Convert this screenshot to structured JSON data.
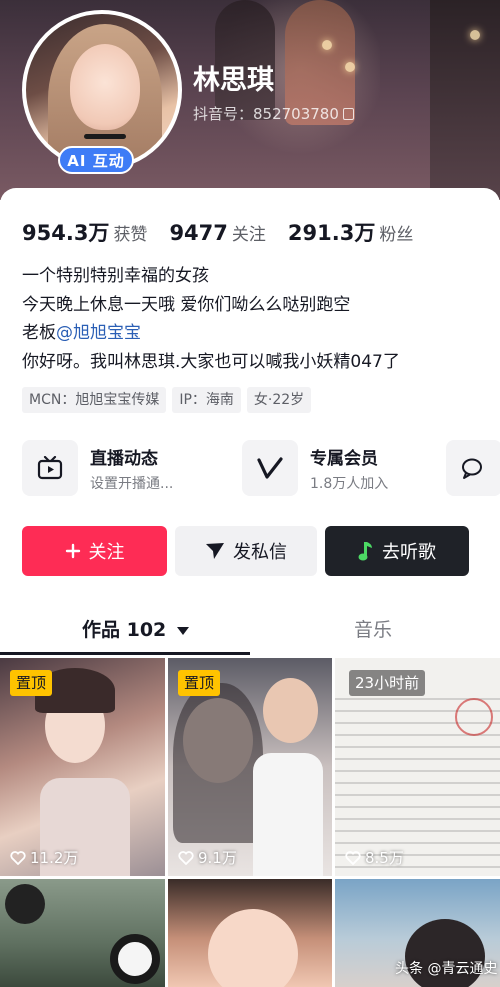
{
  "profile": {
    "nickname": "林思琪",
    "douyin_id": "抖音号：852703780",
    "ai_badge": "AI 互动"
  },
  "stats": [
    {
      "value": "954.3万",
      "label": "获赞"
    },
    {
      "value": "9477",
      "label": "关注"
    },
    {
      "value": "291.3万",
      "label": "粉丝"
    }
  ],
  "bio": {
    "line1": "一个特别特别幸福的女孩",
    "line2": "今天晚上休息一天哦 爱你们呦么么哒别跑空",
    "line3_prefix": "老板",
    "line3_mention": "@旭旭宝宝",
    "line4": "你好呀。我叫林思琪.大家也可以喊我小妖精047了"
  },
  "tags": [
    "MCN：旭旭宝宝传媒",
    "IP：海南",
    "女·22岁"
  ],
  "features": [
    {
      "title": "直播动态",
      "subtitle": "设置开播通...",
      "icon": "tv-icon"
    },
    {
      "title": "专属会员",
      "subtitle": "1.8万人加入",
      "icon": "v-icon"
    },
    {
      "title": "",
      "subtitle": "",
      "icon": "chat-icon"
    }
  ],
  "actions": {
    "follow": "关注",
    "message": "发私信",
    "song": "去听歌"
  },
  "tabs": {
    "works": "作品 102",
    "music": "音乐"
  },
  "posts": [
    {
      "badge": "置顶",
      "likes": "11.2万"
    },
    {
      "badge": "置顶",
      "likes": "9.1万"
    },
    {
      "badge": "23小时前",
      "likes": "8.5万"
    }
  ],
  "watermark": "头条 @青云通史",
  "colors": {
    "accent_red": "#fe2c55",
    "pin_yellow": "#ffc300",
    "ai_blue": "#3e7cf6",
    "dark_button": "#1f2228"
  }
}
